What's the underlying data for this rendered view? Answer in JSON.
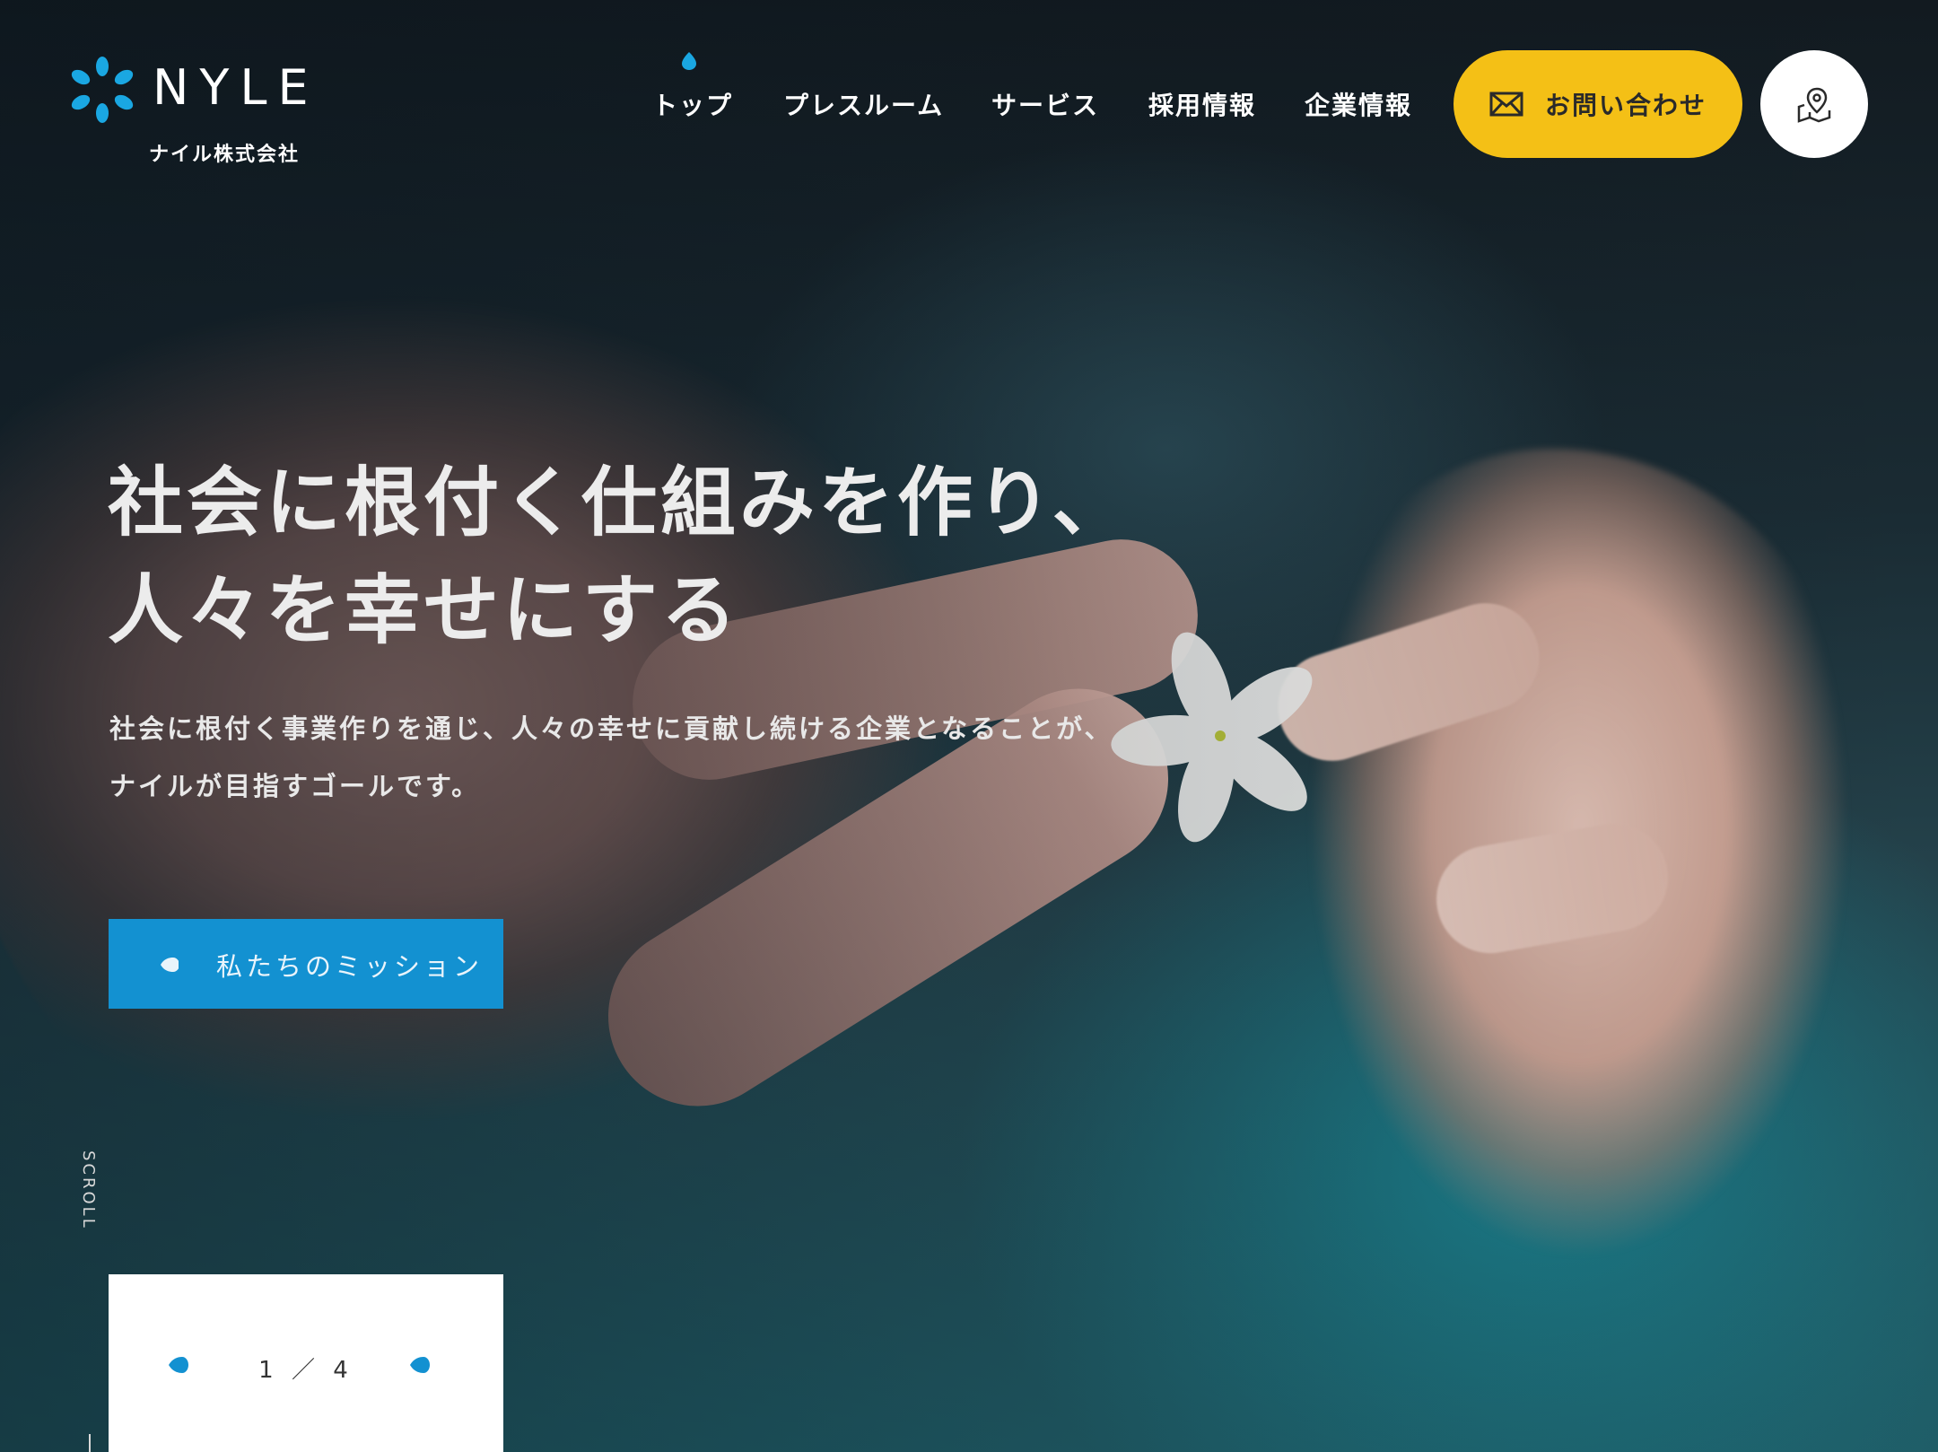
{
  "brand": {
    "name": "NYLE",
    "company": "ナイル株式会社",
    "accent_color": "#1391d1"
  },
  "nav": {
    "items": [
      {
        "label": "トップ",
        "active": true
      },
      {
        "label": "プレスルーム"
      },
      {
        "label": "サービス"
      },
      {
        "label": "採用情報"
      },
      {
        "label": "企業情報"
      }
    ],
    "contact_label": "お問い合わせ",
    "contact_icon": "mail-icon",
    "contact_color": "#f4c016",
    "map_icon": "map-pin-icon"
  },
  "hero": {
    "title_line1": "社会に根付く仕組みを作り、",
    "title_line2": "人々を幸せにする",
    "desc_line1": "社会に根付く事業作りを通じ、人々の幸せに貢献し続ける企業となることが、",
    "desc_line2": "ナイルが目指すゴールです。",
    "cta_label": "私たちのミッション"
  },
  "scroll": {
    "label": "SCROLL"
  },
  "slider": {
    "current": "1",
    "separator": "／",
    "total": "4"
  }
}
